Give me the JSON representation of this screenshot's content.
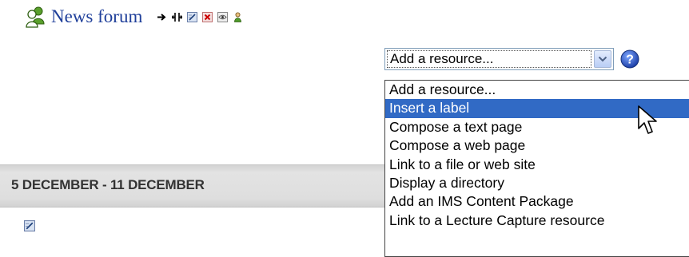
{
  "forum": {
    "title": "News forum",
    "icon": "people-forum-icon",
    "edit_icons": [
      "move-right-icon",
      "move-icon",
      "edit-icon",
      "delete-icon",
      "hide-eye-icon",
      "assign-roles-icon"
    ]
  },
  "resource_select": {
    "selected": "Add a resource...",
    "options": [
      "Add a resource...",
      "Insert a label",
      "Compose a text page",
      "Compose a web page",
      "Link to a file or web site",
      "Display a directory",
      "Add an IMS Content Package",
      "Link to a Lecture Capture resource"
    ],
    "highlighted_index": 1
  },
  "week": {
    "title": "5 DECEMBER - 11 DECEMBER"
  },
  "colors": {
    "link": "#1f3f9a",
    "highlight": "#316ac5",
    "week_bar": "#dedede"
  }
}
